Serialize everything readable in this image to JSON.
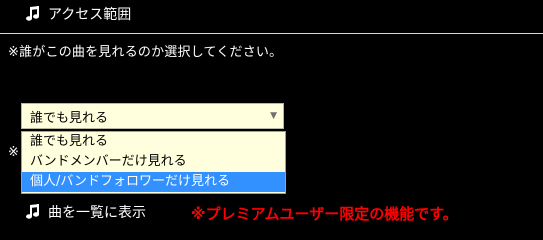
{
  "access": {
    "heading": "アクセス範囲",
    "heading_icon": "music-note-icon",
    "instruction": "※誰がこの曲を見れるのか選択してください。",
    "hidden_mark": "※",
    "select": {
      "value": "誰でも見れる",
      "options": [
        {
          "label": "誰でも見れる",
          "selected": false
        },
        {
          "label": "バンドメンバーだけ見れる",
          "selected": false
        },
        {
          "label": "個人/バンドフォロワーだけ見れる",
          "selected": true
        }
      ]
    }
  },
  "list_display": {
    "label": "曲を一覧に表示",
    "icon": "music-note-icon"
  },
  "premium_note": "※プレミアムユーザー限定の機能です。",
  "colors": {
    "background": "#000000",
    "select_bg": "#ffffdd",
    "highlight": "#3390ff",
    "warning": "#ff0000"
  }
}
